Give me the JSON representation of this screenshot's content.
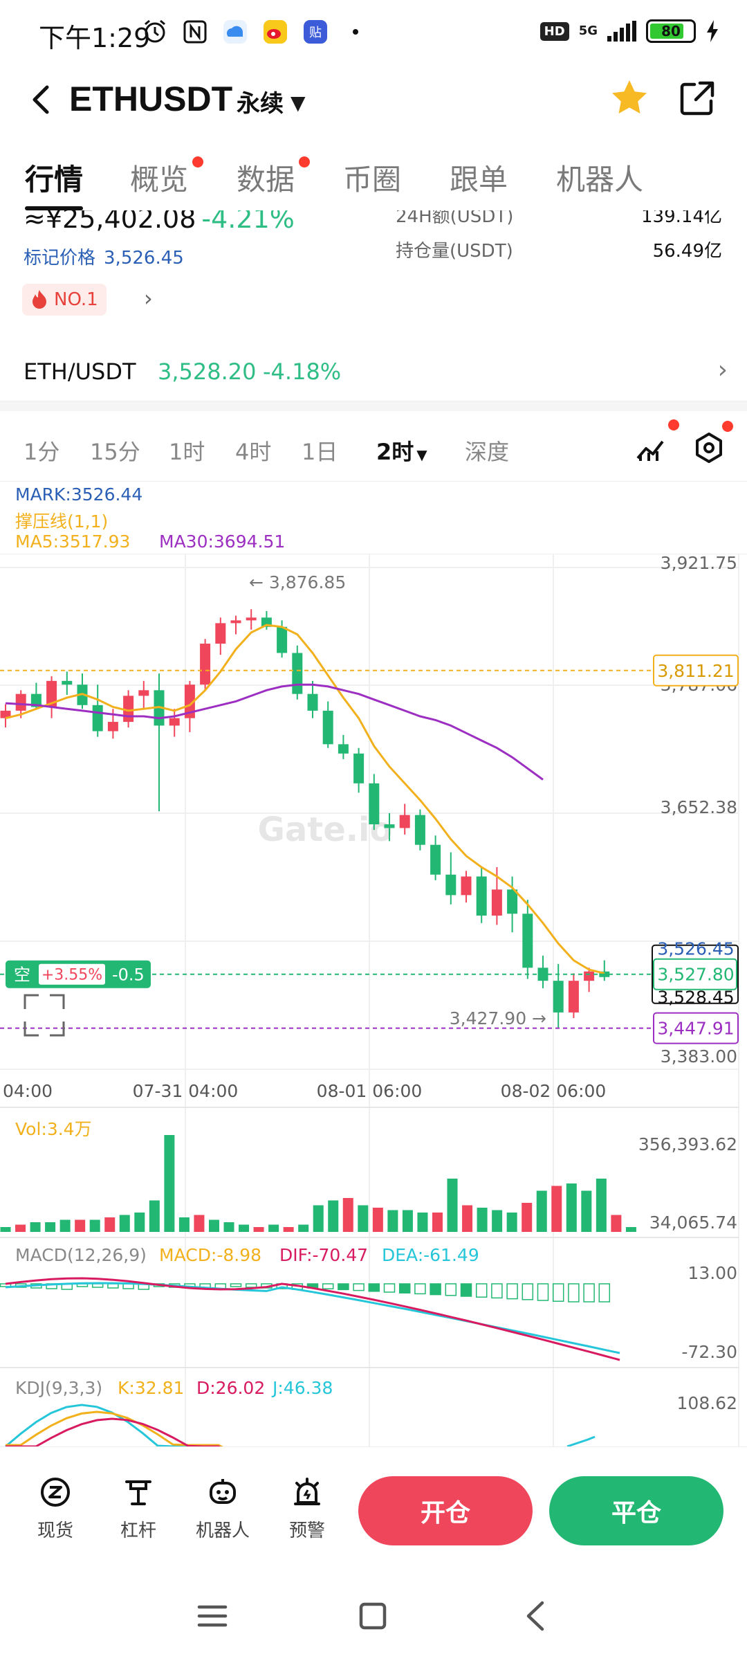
{
  "status_bar": {
    "time": "下午1:29",
    "hd": "HD",
    "network": "5G",
    "battery": "80"
  },
  "header": {
    "title": "ETHUSDT",
    "subtitle": "永续"
  },
  "tabs": [
    {
      "label": "行情",
      "active": true,
      "dot": false
    },
    {
      "label": "概览",
      "active": false,
      "dot": true
    },
    {
      "label": "数据",
      "active": false,
      "dot": true
    },
    {
      "label": "币圈",
      "active": false,
      "dot": false
    },
    {
      "label": "跟单",
      "active": false,
      "dot": false
    },
    {
      "label": "机器人",
      "active": false,
      "dot": false
    }
  ],
  "info": {
    "price_partial": "≈¥25,402.08",
    "change_partial": "-4.21%",
    "mark_label": "标记价格",
    "mark_value": "3,526.45",
    "vol24_label": "24H额(USDT)",
    "vol24_value": "139.14亿",
    "oi_label": "持仓量(USDT)",
    "oi_value": "56.49亿",
    "rank": "NO.1"
  },
  "pair_row": {
    "name": "ETH/USDT",
    "price": "3,528.20",
    "change": "-4.18%"
  },
  "intervals": [
    {
      "label": "1分",
      "active": false
    },
    {
      "label": "15分",
      "active": false
    },
    {
      "label": "1时",
      "active": false
    },
    {
      "label": "4时",
      "active": false
    },
    {
      "label": "1日",
      "active": false
    },
    {
      "label": "2时",
      "active": true
    },
    {
      "label": "深度",
      "active": false
    }
  ],
  "indicators": {
    "mark": "MARK:3526.44",
    "support": "撑压线(1,1)",
    "ma5": "MA5:3517.93",
    "ma30": "MA30:3694.51"
  },
  "chart_data": {
    "type": "candlestick",
    "y_ticks": [
      "3,921.75",
      "3,787.06",
      "3,652.38",
      "3,383.00"
    ],
    "x_ticks": [
      "04:00",
      "07-31 04:00",
      "08-01 06:00",
      "08-02 06:00"
    ],
    "ylim": [
      3383.0,
      3921.75
    ],
    "high_annotation": "3,876.85",
    "low_annotation": "3,427.90",
    "line_tags": {
      "support_price": "3,811.21",
      "current_price": "3,527.80",
      "mark_price_partial": "3,526.45",
      "last_price_partial": "3,528.45",
      "lower_price": "3,447.91"
    },
    "position_tag": {
      "side": "空",
      "pnl": "+3.55%",
      "size": "-0.5"
    },
    "watermark": "Gate.io",
    "candles": [
      {
        "o": 3760,
        "h": 3775,
        "l": 3750,
        "c": 3768
      },
      {
        "o": 3768,
        "h": 3790,
        "l": 3760,
        "c": 3786
      },
      {
        "o": 3786,
        "h": 3798,
        "l": 3770,
        "c": 3772
      },
      {
        "o": 3772,
        "h": 3805,
        "l": 3760,
        "c": 3800
      },
      {
        "o": 3800,
        "h": 3810,
        "l": 3785,
        "c": 3796
      },
      {
        "o": 3796,
        "h": 3808,
        "l": 3770,
        "c": 3774
      },
      {
        "o": 3774,
        "h": 3796,
        "l": 3740,
        "c": 3746
      },
      {
        "o": 3746,
        "h": 3770,
        "l": 3738,
        "c": 3756
      },
      {
        "o": 3756,
        "h": 3790,
        "l": 3750,
        "c": 3784
      },
      {
        "o": 3784,
        "h": 3800,
        "l": 3770,
        "c": 3790
      },
      {
        "o": 3790,
        "h": 3808,
        "l": 3660,
        "c": 3752
      },
      {
        "o": 3752,
        "h": 3770,
        "l": 3740,
        "c": 3760
      },
      {
        "o": 3760,
        "h": 3800,
        "l": 3745,
        "c": 3796
      },
      {
        "o": 3796,
        "h": 3845,
        "l": 3790,
        "c": 3840
      },
      {
        "o": 3840,
        "h": 3868,
        "l": 3828,
        "c": 3862
      },
      {
        "o": 3862,
        "h": 3870,
        "l": 3850,
        "c": 3865
      },
      {
        "o": 3865,
        "h": 3877,
        "l": 3855,
        "c": 3868
      },
      {
        "o": 3868,
        "h": 3875,
        "l": 3855,
        "c": 3858
      },
      {
        "o": 3858,
        "h": 3865,
        "l": 3825,
        "c": 3830
      },
      {
        "o": 3830,
        "h": 3838,
        "l": 3780,
        "c": 3786
      },
      {
        "o": 3786,
        "h": 3800,
        "l": 3760,
        "c": 3768
      },
      {
        "o": 3768,
        "h": 3778,
        "l": 3728,
        "c": 3732
      },
      {
        "o": 3732,
        "h": 3742,
        "l": 3716,
        "c": 3722
      },
      {
        "o": 3722,
        "h": 3728,
        "l": 3680,
        "c": 3690
      },
      {
        "o": 3690,
        "h": 3700,
        "l": 3640,
        "c": 3646
      },
      {
        "o": 3646,
        "h": 3658,
        "l": 3628,
        "c": 3642
      },
      {
        "o": 3642,
        "h": 3668,
        "l": 3635,
        "c": 3656
      },
      {
        "o": 3656,
        "h": 3662,
        "l": 3618,
        "c": 3624
      },
      {
        "o": 3624,
        "h": 3634,
        "l": 3586,
        "c": 3592
      },
      {
        "o": 3592,
        "h": 3616,
        "l": 3560,
        "c": 3570
      },
      {
        "o": 3570,
        "h": 3596,
        "l": 3562,
        "c": 3590
      },
      {
        "o": 3590,
        "h": 3600,
        "l": 3540,
        "c": 3548
      },
      {
        "o": 3548,
        "h": 3600,
        "l": 3538,
        "c": 3576
      },
      {
        "o": 3576,
        "h": 3590,
        "l": 3530,
        "c": 3550
      },
      {
        "o": 3550,
        "h": 3565,
        "l": 3480,
        "c": 3492
      },
      {
        "o": 3492,
        "h": 3505,
        "l": 3470,
        "c": 3478
      },
      {
        "o": 3478,
        "h": 3496,
        "l": 3428,
        "c": 3444
      },
      {
        "o": 3444,
        "h": 3486,
        "l": 3438,
        "c": 3478
      },
      {
        "o": 3478,
        "h": 3492,
        "l": 3466,
        "c": 3488
      },
      {
        "o": 3488,
        "h": 3500,
        "l": 3478,
        "c": 3482
      }
    ],
    "ma5": [
      3760,
      3764,
      3770,
      3776,
      3782,
      3786,
      3780,
      3772,
      3768,
      3770,
      3772,
      3768,
      3774,
      3790,
      3810,
      3834,
      3852,
      3860,
      3858,
      3850,
      3830,
      3806,
      3782,
      3760,
      3730,
      3708,
      3690,
      3672,
      3652,
      3630,
      3612,
      3600,
      3590,
      3578,
      3560,
      3540,
      3518,
      3500,
      3490,
      3486
    ],
    "ma30": [
      3776,
      3775,
      3774,
      3772,
      3770,
      3768,
      3766,
      3764,
      3762,
      3762,
      3760,
      3762,
      3766,
      3770,
      3774,
      3778,
      3784,
      3790,
      3794,
      3796,
      3796,
      3794,
      3790,
      3786,
      3780,
      3774,
      3768,
      3762,
      3758,
      3752,
      3744,
      3736,
      3728,
      3718,
      3706,
      3694
    ],
    "volume": {
      "label": "Vol:3.4万",
      "max_label": "356,393.62",
      "min_label": "34,065.74",
      "values": [
        2,
        3,
        4,
        4,
        5,
        5,
        5,
        6,
        7,
        8,
        13,
        40,
        6,
        7,
        5,
        4,
        3,
        2,
        3,
        2,
        3,
        11,
        13,
        14,
        11,
        10,
        9,
        9,
        8,
        8,
        22,
        11,
        10,
        9,
        8,
        12,
        17,
        19,
        20,
        17,
        22,
        7,
        2
      ]
    },
    "macd": {
      "label": "MACD(12,26,9)",
      "macd": "MACD:-8.98",
      "dif": "DIF:-70.47",
      "dea": "DEA:-61.49",
      "max_label": "13.00",
      "min_label": "-72.30"
    },
    "kdj": {
      "label": "KDJ(9,3,3)",
      "k": "K:32.81",
      "d": "D:26.02",
      "j": "J:46.38",
      "max_label": "108.62"
    }
  },
  "bottom_bar": {
    "items": [
      "现货",
      "杠杆",
      "机器人",
      "预警"
    ],
    "open_label": "开仓",
    "close_label": "平仓"
  },
  "colors": {
    "up": "#f0465b",
    "down": "#22b874",
    "ma5": "#f2b11c",
    "ma30": "#9c2fc2",
    "mark": "#2a5fb5"
  }
}
